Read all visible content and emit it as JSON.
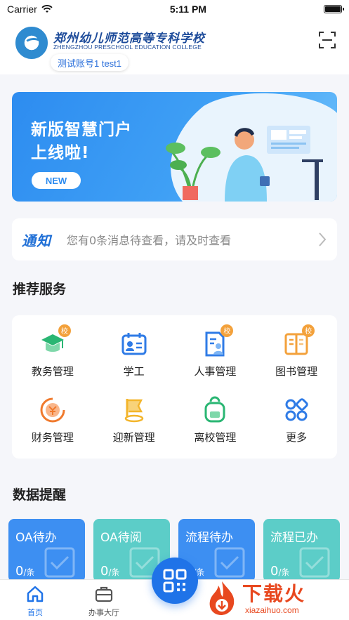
{
  "status_bar": {
    "carrier": "Carrier",
    "time": "5:11 PM"
  },
  "header": {
    "school_name_cn": "郑州幼儿师范高等专科学校",
    "school_name_en": "ZHENGZHOU PRESCHOOL EDUCATION COLLEGE",
    "account": "测试账号1 test1"
  },
  "banner": {
    "title_line1": "新版智慧门户",
    "title_line2": "上线啦!",
    "button": "NEW"
  },
  "notice": {
    "badge": "通知",
    "text": "您有0条消息待查看，请及时查看"
  },
  "services": {
    "title": "推荐服务",
    "items": [
      {
        "label": "教务管理",
        "icon": "graduation-cap-icon",
        "badge": "校",
        "color": "#2ab673"
      },
      {
        "label": "学工",
        "icon": "id-card-icon",
        "badge": "",
        "color": "#2f7be6"
      },
      {
        "label": "人事管理",
        "icon": "person-file-icon",
        "badge": "校",
        "color": "#2f7be6"
      },
      {
        "label": "图书管理",
        "icon": "book-icon",
        "badge": "校",
        "color": "#f3a13b"
      },
      {
        "label": "财务管理",
        "icon": "finance-icon",
        "badge": "",
        "color": "#f07a2d"
      },
      {
        "label": "迎新管理",
        "icon": "flag-icon",
        "badge": "",
        "color": "#f3b52b"
      },
      {
        "label": "离校管理",
        "icon": "backpack-icon",
        "badge": "",
        "color": "#2ab673"
      },
      {
        "label": "更多",
        "icon": "grid-more-icon",
        "badge": "",
        "color": "#2f7be6"
      }
    ]
  },
  "data_reminder": {
    "title": "数据提醒",
    "cards": [
      {
        "label": "OA待办",
        "count": "0",
        "unit": "/条",
        "color": "#3d8ff2"
      },
      {
        "label": "OA待阅",
        "count": "0",
        "unit": "/条",
        "color": "#5ccdc8"
      },
      {
        "label": "流程待办",
        "count": "0",
        "unit": "/条",
        "color": "#3d8ff2"
      },
      {
        "label": "流程已办",
        "count": "0",
        "unit": "/条",
        "color": "#5ccdc8"
      }
    ]
  },
  "tabbar": {
    "home": "首页",
    "office": "办事大厅"
  },
  "watermark": {
    "cn": "下载火",
    "en": "xiazaihuo.com"
  }
}
